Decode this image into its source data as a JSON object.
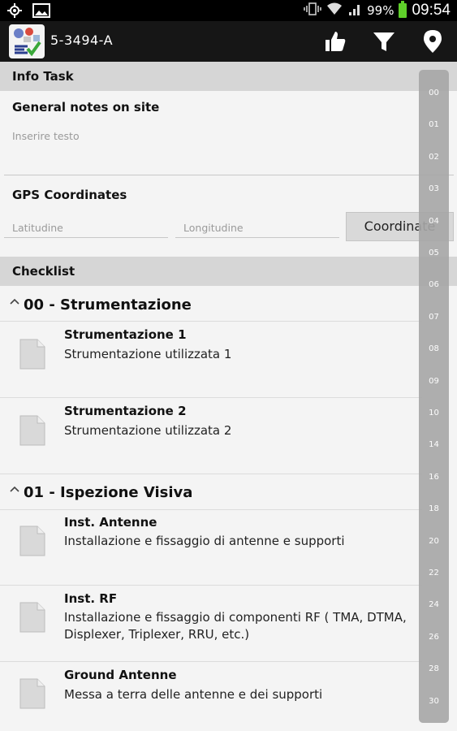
{
  "status_bar": {
    "battery": "99%",
    "time": "09:54",
    "left_icons": [
      "gps-icon",
      "image-icon"
    ],
    "right_icons": [
      "vibrate-icon",
      "wifi-icon",
      "signal-icon",
      "battery-icon"
    ]
  },
  "action_bar": {
    "title": "5-3494-A",
    "actions": [
      "thumbs-up-icon",
      "filter-icon",
      "location-pin-icon"
    ]
  },
  "info_task": {
    "header": "Info Task",
    "notes_label": "General notes on site",
    "notes_placeholder": "Inserire testo",
    "gps_label": "GPS Coordinates",
    "latitude_placeholder": "Latitudine",
    "longitude_placeholder": "Longitudine",
    "coordinate_button": "Coordinate"
  },
  "checklist": {
    "header": "Checklist",
    "groups": [
      {
        "title": "00 - Strumentazione",
        "items": [
          {
            "title": "Strumentazione 1",
            "desc": "Strumentazione utilizzata 1"
          },
          {
            "title": "Strumentazione 2",
            "desc": "Strumentazione utilizzata 2"
          }
        ]
      },
      {
        "title": "01 - Ispezione Visiva",
        "items": [
          {
            "title": "Inst. Antenne",
            "desc": "Installazione e fissaggio di antenne e supporti"
          },
          {
            "title": "Inst. RF",
            "desc": "Installazione e fissaggio di componenti RF ( TMA, DTMA, Displexer, Triplexer, RRU, etc.)"
          },
          {
            "title": "Ground Antenne",
            "desc": "Messa a terra delle antenne e dei supporti"
          }
        ]
      }
    ]
  },
  "index": [
    "00",
    "01",
    "02",
    "03",
    "04",
    "05",
    "06",
    "07",
    "08",
    "09",
    "10",
    "14",
    "16",
    "18",
    "20",
    "22",
    "24",
    "26",
    "28",
    "30"
  ],
  "colors": {
    "action_bar": "#161616",
    "section_header": "#d6d6d6",
    "battery": "#5fcf2a",
    "index_bar": "#a7a7a7"
  }
}
